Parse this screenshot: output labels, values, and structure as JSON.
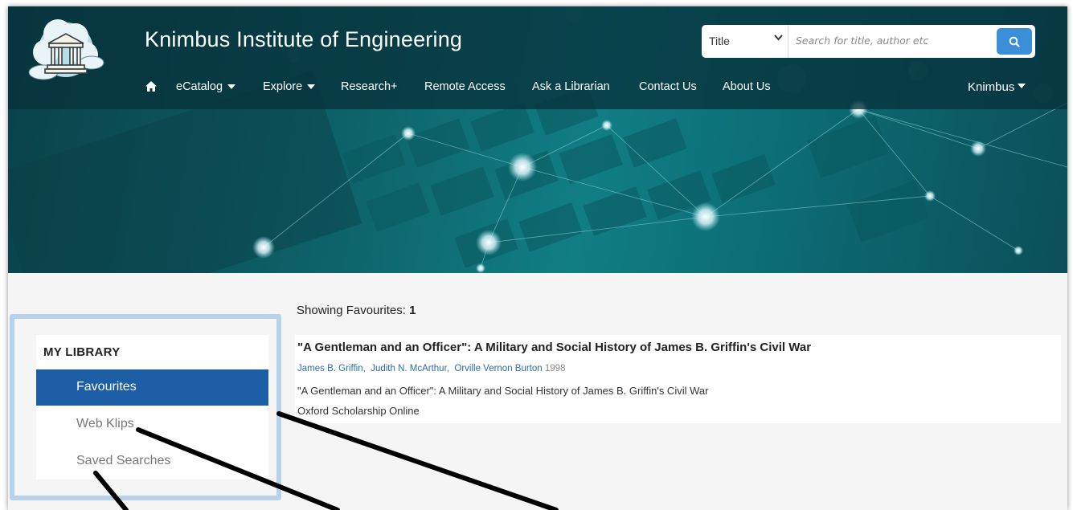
{
  "header": {
    "site_title": "Knimbus Institute of Engineering",
    "search": {
      "field_type": "Title",
      "placeholder": "Search for title, author etc",
      "button_icon": "search-icon"
    },
    "nav": {
      "home_icon": "home-icon",
      "items": [
        "eCatalog",
        "Explore",
        "Research+",
        "Remote Access",
        "Ask a Librarian",
        "Contact Us",
        "About Us"
      ],
      "user_menu": "Knimbus"
    }
  },
  "sidebar": {
    "heading": "MY LIBRARY",
    "items": [
      {
        "label": "Favourites",
        "active": true
      },
      {
        "label": "Web Klips",
        "active": false
      },
      {
        "label": "Saved Searches",
        "active": false
      }
    ]
  },
  "results": {
    "showing_label": "Showing Favourites:",
    "showing_count": "1",
    "items": [
      {
        "title": "\"A Gentleman and an Officer\": A Military and Social History of James B. Griffin's Civil War",
        "authors": [
          "James B. Griffin",
          "Judith N. McArthur",
          "Orville Vernon Burton"
        ],
        "year": "1998",
        "description": "\"A Gentleman and an Officer\": A Military and Social History of James B. Griffin's Civil War",
        "source": "Oxford Scholarship Online"
      }
    ]
  },
  "colors": {
    "accent_blue": "#1d5fa6",
    "search_button": "#3a8fd8",
    "nav_bg": "#06323c",
    "highlight_border": "#b7d2ec"
  }
}
